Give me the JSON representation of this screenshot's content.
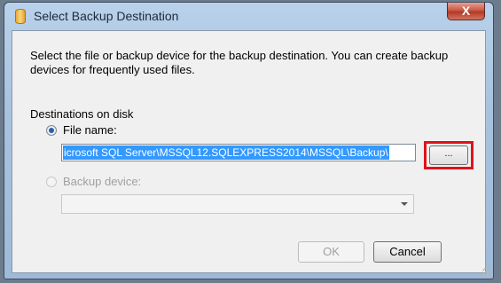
{
  "window": {
    "title": "Select Backup Destination",
    "close_glyph": "X"
  },
  "description": "Select the file or backup device for the backup destination. You can create backup devices for frequently used files.",
  "destinations_label": "Destinations on disk",
  "file_name_option": {
    "label": "File name:",
    "selected": true
  },
  "file_name_value": "icrosoft SQL Server\\MSSQL12.SQLEXPRESS2014\\MSSQL\\Backup\\",
  "browse_button": {
    "label": "..."
  },
  "backup_device_option": {
    "label": "Backup device:",
    "selected": false,
    "enabled": false
  },
  "backup_device_value": "",
  "buttons": {
    "ok": "OK",
    "cancel": "Cancel"
  },
  "colors": {
    "selection": "#3399ff",
    "highlight_box": "#e0121a",
    "close_button": "#c75b46"
  }
}
